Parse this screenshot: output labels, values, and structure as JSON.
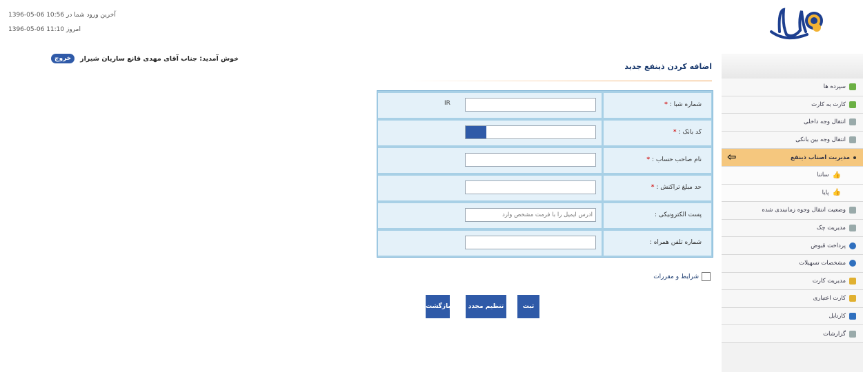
{
  "login_info": {
    "last_login": "آخرین ورود شما در 10:56 06-05-1396",
    "today": "امروز 11:10 06-05-1396"
  },
  "welcome": {
    "text": "خوش آمدید: جناب آقای مهدی قانع ساریان شیراز",
    "logout_label": "خروج"
  },
  "form": {
    "title": "اضافه کردن ذینفع جدید",
    "required_mark": "*",
    "sheba_prefix": "IR",
    "fields": [
      {
        "label": "شماره شبا :",
        "required": true,
        "value": "",
        "placeholder": ""
      },
      {
        "label": "کد بانک :",
        "required": true,
        "value": "",
        "placeholder": ""
      },
      {
        "label": "نام صاحب حساب :",
        "required": true,
        "value": "",
        "placeholder": ""
      },
      {
        "label": "حد مبلغ تراکنش :",
        "required": true,
        "value": "",
        "placeholder": ""
      },
      {
        "label": "پست الکترونیکی :",
        "required": false,
        "value": "",
        "placeholder": "آدرس ایمیل را با فرمت مشخص وارد"
      },
      {
        "label": "شماره تلفن همراه :",
        "required": false,
        "value": "",
        "placeholder": ""
      }
    ],
    "terms_label": "شرایط و مقررات",
    "buttons": {
      "submit": "ثبت",
      "reset": "تنظیم مجدد",
      "back": "بازگشت"
    }
  },
  "sidebar": {
    "items": [
      {
        "label": "سپرده ها",
        "icon": "deposit-icon"
      },
      {
        "label": "کارت به کارت",
        "icon": "card-transfer-icon"
      },
      {
        "label": "انتقال وجه داخلی",
        "icon": "internal-transfer-icon"
      },
      {
        "label": "انتقال وجه بین بانکی",
        "icon": "interbank-transfer-icon"
      },
      {
        "label": "مدیریت اصناب ذینفع",
        "icon": "beneficiary-icon",
        "active": true
      },
      {
        "label": "ساتنا",
        "icon": "thumb-icon",
        "sub": true
      },
      {
        "label": "پایا",
        "icon": "thumb-icon",
        "sub": true
      },
      {
        "label": "وضعیت انتقال وجوه زمانبندی شده",
        "icon": "schedule-icon"
      },
      {
        "label": "مدیریت چک",
        "icon": "cheque-icon"
      },
      {
        "label": "پرداخت قبوض",
        "icon": "bill-icon"
      },
      {
        "label": "مشخصات تسهیلات",
        "icon": "loan-icon"
      },
      {
        "label": "مدیریت کارت",
        "icon": "card-icon"
      },
      {
        "label": "کارت اعتباری",
        "icon": "credit-card-icon"
      },
      {
        "label": "کارتابل",
        "icon": "cartable-icon"
      },
      {
        "label": "گزارشات",
        "icon": "report-icon"
      }
    ]
  },
  "colors": {
    "primary_button": "#2f5aa8",
    "active_menu": "#f5c77e",
    "form_cell": "#e4f1f9",
    "required": "#d31f1f"
  }
}
